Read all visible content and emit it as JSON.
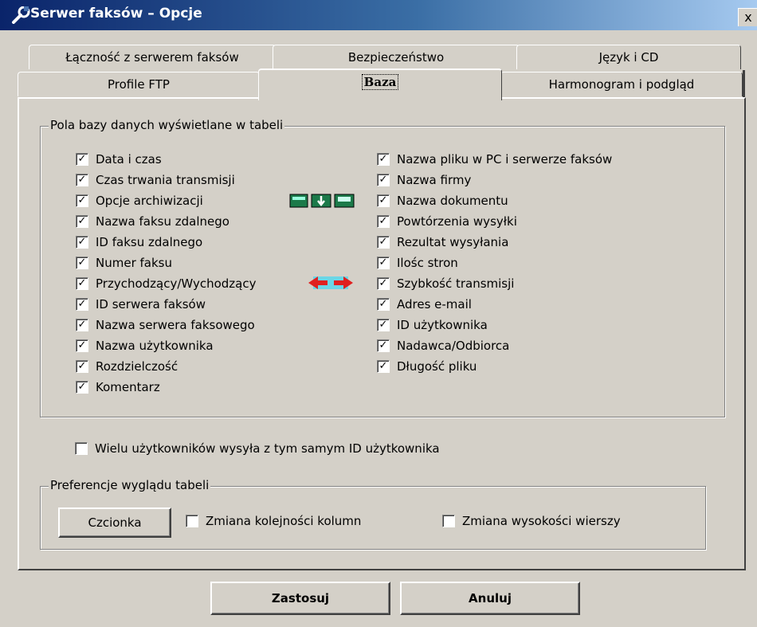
{
  "window": {
    "title": "Serwer faksów – Opcje",
    "title_icon": "wrench-icon",
    "close_label": "x"
  },
  "tabs": {
    "row_back": [
      {
        "label": "Łączność z serwerem faksów"
      },
      {
        "label": "Bezpieczeństwo"
      },
      {
        "label": "Język i CD"
      }
    ],
    "row_front": [
      {
        "label": "Profile FTP"
      },
      {
        "label": "Baza",
        "active": true
      },
      {
        "label": "Harmonogram i podgląd"
      }
    ]
  },
  "db_fields": {
    "legend": "Pola bazy danych wyświetlane w tabeli",
    "left": [
      {
        "label": "Data i czas",
        "checked": true
      },
      {
        "label": "Czas trwania transmisji",
        "checked": true
      },
      {
        "label": "Opcje archiwizacji",
        "checked": true
      },
      {
        "label": "Nazwa faksu zdalnego",
        "checked": true
      },
      {
        "label": "ID faksu zdalnego",
        "checked": true
      },
      {
        "label": "Numer faksu",
        "checked": true
      },
      {
        "label": "Przychodzący/Wychodzący",
        "checked": true
      },
      {
        "label": "ID serwera faksów",
        "checked": true
      },
      {
        "label": "Nazwa serwera faksowego",
        "checked": true
      },
      {
        "label": "Nazwa użytkownika",
        "checked": true
      },
      {
        "label": "Rozdzielczość",
        "checked": true
      },
      {
        "label": "Komentarz",
        "checked": true
      }
    ],
    "right": [
      {
        "label": "Nazwa pliku w PC i serwerze faksów",
        "checked": true
      },
      {
        "label": "Nazwa firmy",
        "checked": true
      },
      {
        "label": "Nazwa dokumentu",
        "checked": true
      },
      {
        "label": "Powtórzenia wysyłki",
        "checked": true
      },
      {
        "label": "Rezultat wysyłania",
        "checked": true
      },
      {
        "label": "Ilośc stron",
        "checked": true
      },
      {
        "label": "Szybkość transmisji",
        "checked": true
      },
      {
        "label": "Adres e-mail",
        "checked": true
      },
      {
        "label": "ID użytkownika",
        "checked": true
      },
      {
        "label": "Nadawca/Odbiorca",
        "checked": true
      },
      {
        "label": "Długość pliku",
        "checked": true
      }
    ],
    "archive_icon": "archive-options-icon",
    "direction_icon": "in-out-arrows-icon"
  },
  "multi_user": {
    "label": "Wielu użytkowników wysyła z tym samym ID użytkownika",
    "checked": false
  },
  "appearance": {
    "legend": "Preferencje wyglądu tabeli",
    "font_button": "Czcionka",
    "reorder_columns": {
      "label": "Zmiana kolejności kolumn",
      "checked": false
    },
    "row_height": {
      "label": "Zmiana wysokości wierszy",
      "checked": false
    }
  },
  "buttons": {
    "apply": "Zastosuj",
    "cancel": "Anuluj"
  },
  "colors": {
    "face": "#d4d0c8",
    "title_start": "#0a246a",
    "title_end": "#a6caf0"
  }
}
